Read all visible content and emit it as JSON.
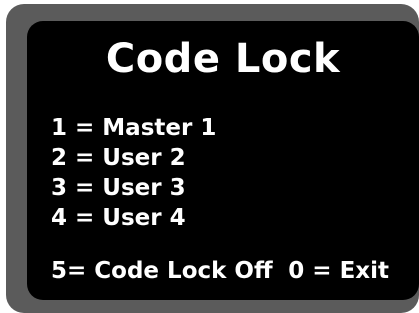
{
  "screen": {
    "title": "Code Lock",
    "options": [
      "1 = Master 1",
      "2 = User 2",
      "3 = User 3",
      "4 = User 4"
    ],
    "footer_left": "5= Code Lock Off",
    "footer_right": "0 = Exit"
  },
  "colors": {
    "bezel": "#5b5b5b",
    "screen_background": "#000000",
    "text": "#ffffff"
  }
}
